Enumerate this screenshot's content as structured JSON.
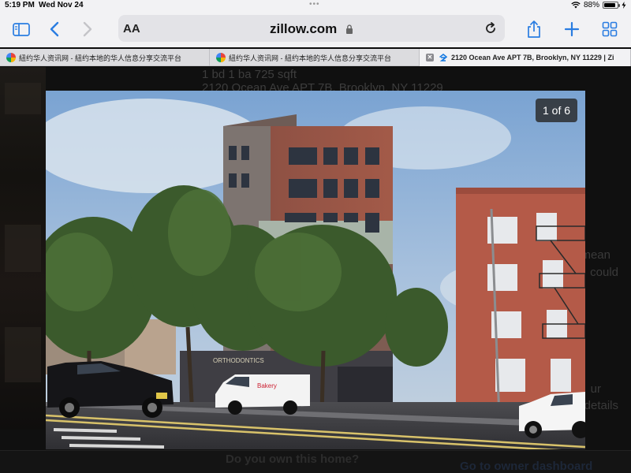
{
  "status_bar": {
    "time": "5:19 PM",
    "date": "Wed Nov 24",
    "battery": "88%",
    "battery_level": 0.88,
    "icons": [
      "wifi-icon",
      "battery-icon",
      "charging-bolt-icon"
    ]
  },
  "toolbar": {
    "icons": [
      "sidebar-icon",
      "back-arrow-icon",
      "forward-arrow-icon",
      "share-icon",
      "new-tab-plus-icon",
      "tab-overview-icon"
    ],
    "reader_label": "AA",
    "url": "zillow.com",
    "accent_color": "#2a7de1"
  },
  "tabs": [
    {
      "label": "紐约华人资讯网 - 紐约本地的华人信息分享交流平台",
      "icon": "globe-favicon",
      "active": false
    },
    {
      "label": "紐约华人资讯网 - 紐约本地的华人信息分享交流平台",
      "icon": "globe-favicon",
      "active": false
    },
    {
      "label": "2120 Ocean Ave APT 7B, Brooklyn, NY 11229 | Zi",
      "icon": "zillow-favicon",
      "active": true
    }
  ],
  "background_page": {
    "details": "1 bd   1 ba   725 sqft",
    "address": "2120 Ocean Ave APT 7B, Brooklyn, NY 11229",
    "side_texts": [
      "mean",
      "could",
      "ur",
      "details"
    ],
    "owner_question": "Do you own this home?",
    "owner_link": "Go to owner dashboard"
  },
  "photo_viewer": {
    "counter": "1 of 6",
    "sign_text": "ORTHODONTICS",
    "van_text": "Bakery"
  }
}
